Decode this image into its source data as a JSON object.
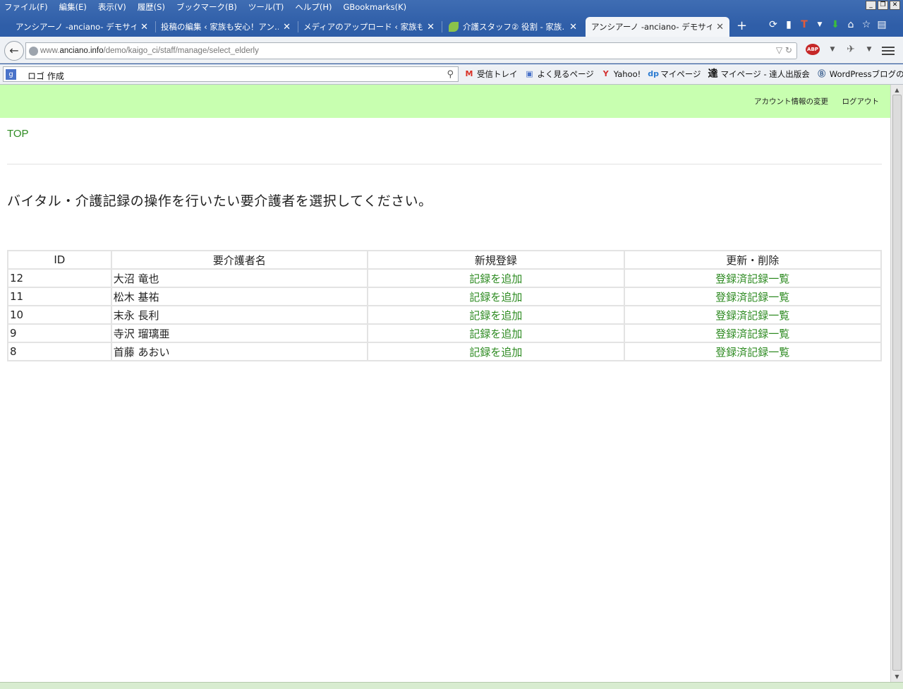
{
  "menubar": {
    "items": [
      "ファイル(F)",
      "編集(E)",
      "表示(V)",
      "履歴(S)",
      "ブックマーク(B)",
      "ツール(T)",
      "ヘルプ(H)",
      "GBookmarks(K)"
    ]
  },
  "tabs": [
    {
      "label": "アンシアーノ -anciano- デモサイ…"
    },
    {
      "label": "投稿の編集 ‹ 家族も安心！アン…"
    },
    {
      "label": "メディアのアップロード ‹ 家族も安…"
    },
    {
      "label": "介護スタッフ② 役割 - 家族…"
    },
    {
      "label": "アンシアーノ -anciano- デモサイト…"
    }
  ],
  "urlbar": {
    "prefix": "www.",
    "domain": "anciano.info",
    "path": "/demo/kaigo_ci/staff/manage/select_elderly"
  },
  "searchbar": {
    "query": "ロゴ 作成"
  },
  "bookmarks": [
    {
      "label": "受信トレイ",
      "icon": "gmail-icon"
    },
    {
      "label": "よく見るページ",
      "icon": "frequent-pages-icon"
    },
    {
      "label": "Yahoo!",
      "icon": "yahoo-icon"
    },
    {
      "label": "マイページ",
      "icon": "mypage-icon"
    },
    {
      "label": "マイページ - 達人出版会",
      "icon": "tatsujin-icon"
    },
    {
      "label": "WordPressブログの作成…",
      "icon": "wordpress-icon"
    }
  ],
  "header": {
    "account_label": "アカウント情報の変更",
    "logout_label": "ログアウト"
  },
  "nav": {
    "top_label": "TOP"
  },
  "main": {
    "heading": "バイタル・介護記録の操作を行いたい要介護者を選択してください。"
  },
  "table": {
    "columns": [
      "ID",
      "要介護者名",
      "新規登録",
      "更新・削除"
    ],
    "rows": [
      {
        "id": "12",
        "name": "大沼 竜也",
        "add": "記録を追加",
        "list": "登録済記録一覧"
      },
      {
        "id": "11",
        "name": "松木 基祐",
        "add": "記録を追加",
        "list": "登録済記録一覧"
      },
      {
        "id": "10",
        "name": "末永 長利",
        "add": "記録を追加",
        "list": "登録済記録一覧"
      },
      {
        "id": "9",
        "name": "寺沢 瑠璃亜",
        "add": "記録を追加",
        "list": "登録済記録一覧"
      },
      {
        "id": "8",
        "name": "首藤 あおい",
        "add": "記録を追加",
        "list": "登録済記録一覧"
      }
    ]
  },
  "colors": {
    "header_bg": "#c8ffb0",
    "link": "#2e8b22"
  }
}
